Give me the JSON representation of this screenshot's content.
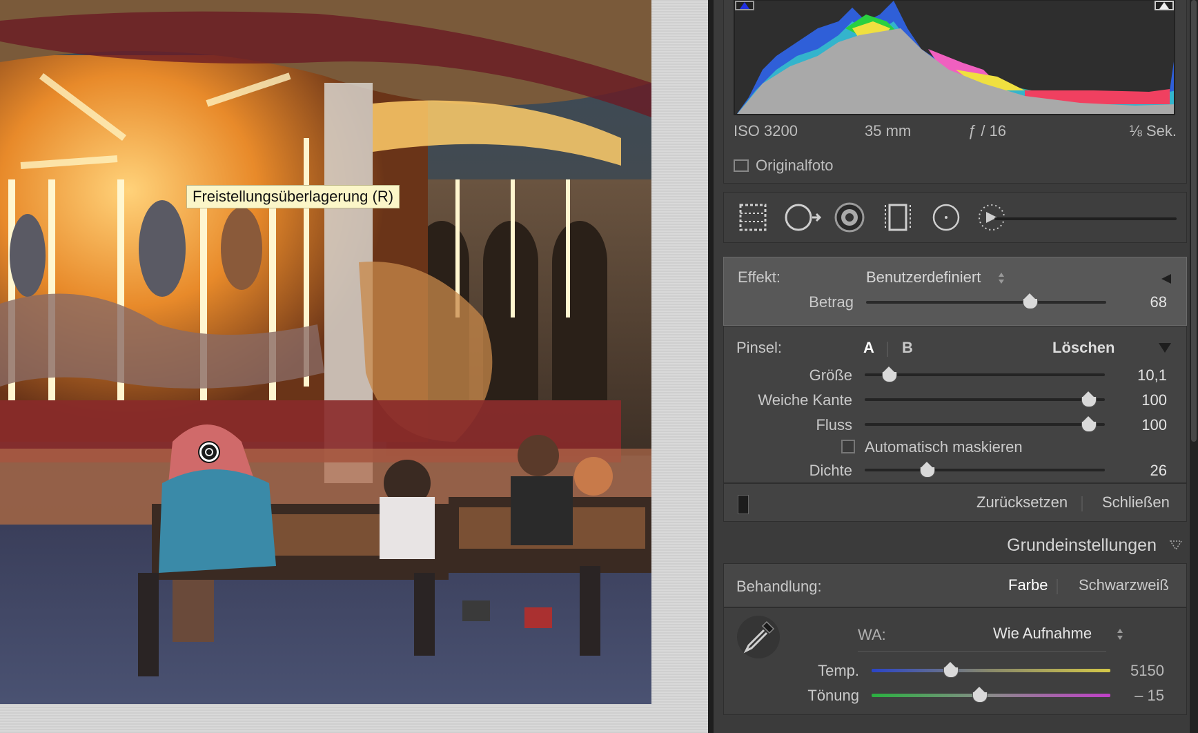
{
  "tooltip": {
    "text": "Freistellungsüberlagerung (R)"
  },
  "histogram": {
    "iso": "ISO 3200",
    "focal": "35 mm",
    "aperture": "ƒ / 16",
    "shutter": "⅛ Sek.",
    "original_photo_label": "Originalfoto"
  },
  "tools": [
    "crop-overlay",
    "spot-removal",
    "red-eye",
    "graduated-filter",
    "radial-filter",
    "adjustment-brush"
  ],
  "effect": {
    "label": "Effekt:",
    "preset": "Benutzerdefiniert",
    "amount_label": "Betrag",
    "amount_value": "68",
    "amount_fraction": 0.68
  },
  "brush": {
    "label": "Pinsel:",
    "a": "A",
    "b": "B",
    "erase": "Löschen",
    "size_label": "Größe",
    "size_value": "10,1",
    "size_fraction": 0.1,
    "feather_label": "Weiche Kante",
    "feather_value": "100",
    "feather_fraction": 1.0,
    "flow_label": "Fluss",
    "flow_value": "100",
    "flow_fraction": 1.0,
    "automask_label": "Automatisch maskieren",
    "density_label": "Dichte",
    "density_value": "26",
    "density_fraction": 0.26
  },
  "footer": {
    "reset": "Zurücksetzen",
    "close": "Schließen"
  },
  "basic": {
    "title": "Grundeinstellungen",
    "treatment_label": "Behandlung:",
    "color": "Farbe",
    "bw": "Schwarzweiß",
    "wb_label": "WA:",
    "wb_value": "Wie Aufnahme",
    "temp_label": "Temp.",
    "temp_value": "5150",
    "temp_fraction": 0.33,
    "tint_label": "Tönung",
    "tint_value": "– 15",
    "tint_fraction": 0.45
  }
}
